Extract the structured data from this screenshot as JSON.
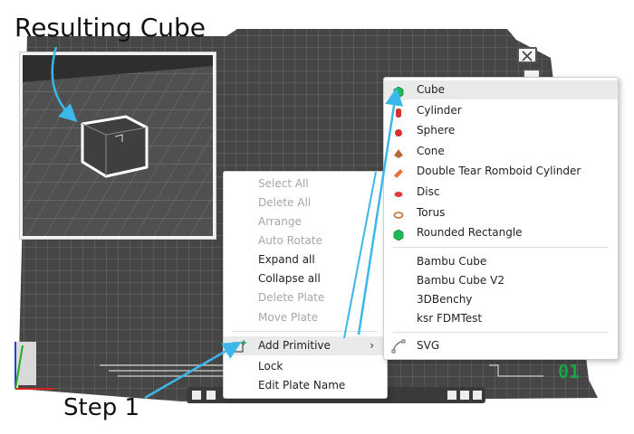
{
  "annotations": {
    "result_label": "Resulting Cube",
    "step_label": "Step 1"
  },
  "plate": {
    "number": "01"
  },
  "context_menu": {
    "items": [
      {
        "label": "Select All",
        "enabled": false
      },
      {
        "label": "Delete All",
        "enabled": false
      },
      {
        "label": "Arrange",
        "enabled": false
      },
      {
        "label": "Auto Rotate",
        "enabled": false
      },
      {
        "label": "Expand all",
        "enabled": true
      },
      {
        "label": "Collapse all",
        "enabled": true
      },
      {
        "label": "Delete Plate",
        "enabled": false
      },
      {
        "label": "Move Plate",
        "enabled": false
      },
      {
        "label": "Add Primitive",
        "enabled": true,
        "submenu": true,
        "icon": "add-primitive-icon"
      },
      {
        "label": "Lock",
        "enabled": true
      },
      {
        "label": "Edit Plate Name",
        "enabled": true
      }
    ],
    "submenu_chevron": "›"
  },
  "primitive_menu": {
    "shapes": [
      {
        "label": "Cube",
        "icon": "cube-icon",
        "color": "#1db954"
      },
      {
        "label": "Cylinder",
        "icon": "cylinder-icon",
        "color": "#d93030"
      },
      {
        "label": "Sphere",
        "icon": "sphere-icon",
        "color": "#d93030"
      },
      {
        "label": "Cone",
        "icon": "cone-icon",
        "color": "#b86a3a"
      },
      {
        "label": "Double Tear Romboid Cylinder",
        "icon": "double-tear-icon",
        "color": "#e8743a"
      },
      {
        "label": "Disc",
        "icon": "disc-icon",
        "color": "#e23a3a"
      },
      {
        "label": "Torus",
        "icon": "torus-icon",
        "color": "#c77a46"
      },
      {
        "label": "Rounded Rectangle",
        "icon": "rounded-rect-icon",
        "color": "#1db954"
      }
    ],
    "models": [
      {
        "label": "Bambu Cube"
      },
      {
        "label": "Bambu Cube V2"
      },
      {
        "label": "3DBenchy"
      },
      {
        "label": "ksr FDMTest"
      }
    ],
    "svg_item": {
      "label": "SVG",
      "icon": "svg-path-icon"
    }
  },
  "colors": {
    "plate": "#4a4a4a",
    "grid": "#6b6b6b",
    "arrow": "#3bb7ea",
    "accent_green": "#1aa34a"
  }
}
